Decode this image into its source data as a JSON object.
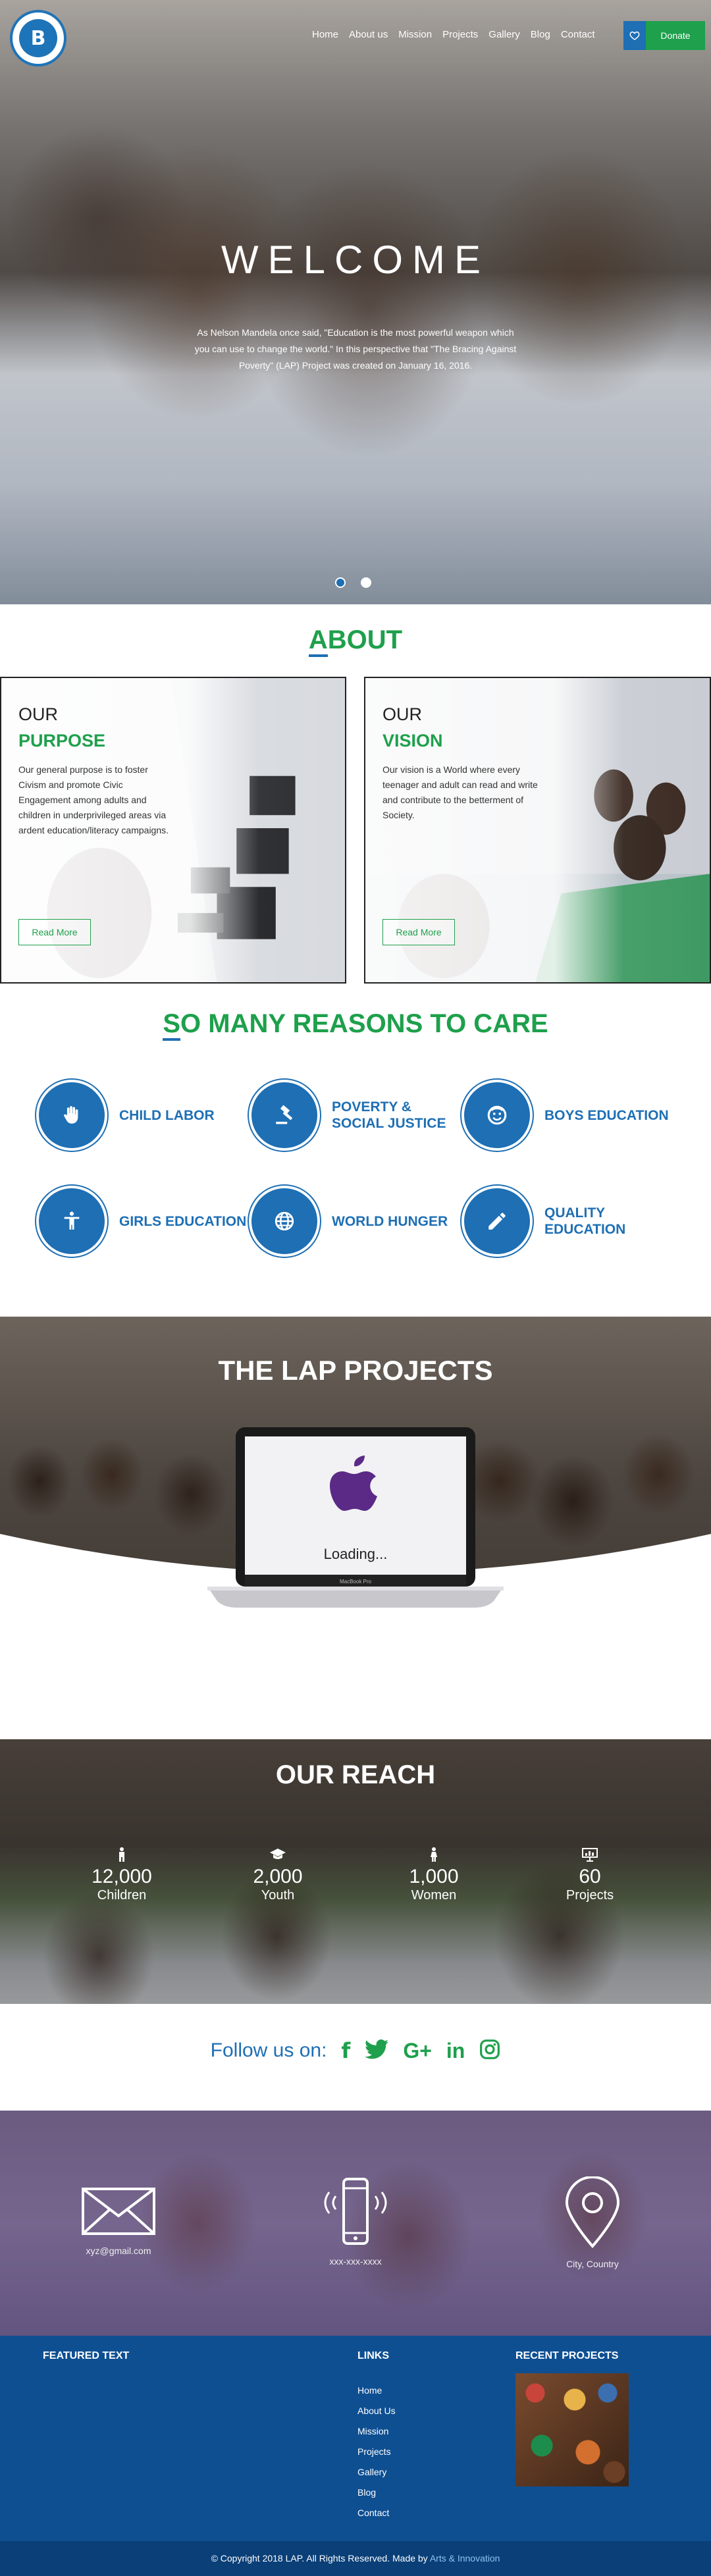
{
  "nav": {
    "items": [
      "Home",
      "About us",
      "Mission",
      "Projects",
      "Gallery",
      "Blog",
      "Contact"
    ],
    "donate_label": "Donate",
    "heart_icon": "heart-icon"
  },
  "logo": {
    "letter": "B"
  },
  "hero": {
    "title": "WELCOME",
    "text": "As Nelson Mandela once said, \"Education is the most powerful weapon which you can use to change the world.\" In this perspective that \"The Bracing Against Poverty\" (LAP) Project was created on January 16, 2016."
  },
  "about": {
    "heading_first": "A",
    "heading_rest": "BOUT",
    "cards": [
      {
        "line1": "OUR",
        "line2": "PURPOSE",
        "text": "Our general purpose is to foster Civism and promote Civic Engagement among adults and children in underprivileged areas via ardent education/literacy campaigns.",
        "button": "Read More"
      },
      {
        "line1": "OUR",
        "line2": "VISION",
        "text": "Our vision is a World where every teenager and adult can read and write and contribute to the betterment of Society.",
        "button": "Read More"
      }
    ]
  },
  "reasons": {
    "heading_first": "S",
    "heading_rest": "O MANY REASONS TO CARE",
    "items": [
      {
        "label": "CHILD LABOR",
        "icon": "hand-icon"
      },
      {
        "label": "POVERTY & SOCIAL JUSTICE",
        "icon": "gavel-icon"
      },
      {
        "label": "BOYS EDUCATION",
        "icon": "face-icon"
      },
      {
        "label": "GIRLS EDUCATION",
        "icon": "person-icon"
      },
      {
        "label": "WORLD HUNGER",
        "icon": "globe-icon"
      },
      {
        "label": "QUALITY EDUCATION",
        "icon": "pencil-icon"
      }
    ]
  },
  "projects": {
    "title": "THE LAP PROJECTS",
    "loading": "Loading...",
    "laptop_brand": "MacBook Pro"
  },
  "reach": {
    "title": "OUR REACH",
    "stats": [
      {
        "value": "12,000",
        "label": "Children",
        "icon": "child-icon"
      },
      {
        "value": "2,000",
        "label": "Youth",
        "icon": "graduation-cap-icon"
      },
      {
        "value": "1,000",
        "label": "Women",
        "icon": "woman-icon"
      },
      {
        "value": "60",
        "label": "Projects",
        "icon": "presentation-icon"
      }
    ]
  },
  "follow": {
    "label": "Follow us on:",
    "networks": [
      "f",
      "twitter",
      "G+",
      "in",
      "instagram"
    ]
  },
  "contact": {
    "email": "xyz@gmail.com",
    "phone": "xxx-xxx-xxxx",
    "location": "City, Country"
  },
  "footer": {
    "featured_heading": "FEATURED TEXT",
    "links_heading": "LINKS",
    "links": [
      "Home",
      "About Us",
      "Mission",
      "Projects",
      "Gallery",
      "Blog",
      "Contact"
    ],
    "recent_heading": "RECENT PROJECTS",
    "copyright": "© Copyright 2018 LAP. All Rights Reserved. Made by ",
    "maker": "Arts & Innovation"
  },
  "colors": {
    "green": "#1ea04c",
    "blue": "#1e6fb4",
    "footer_blue": "#0e4f92"
  }
}
